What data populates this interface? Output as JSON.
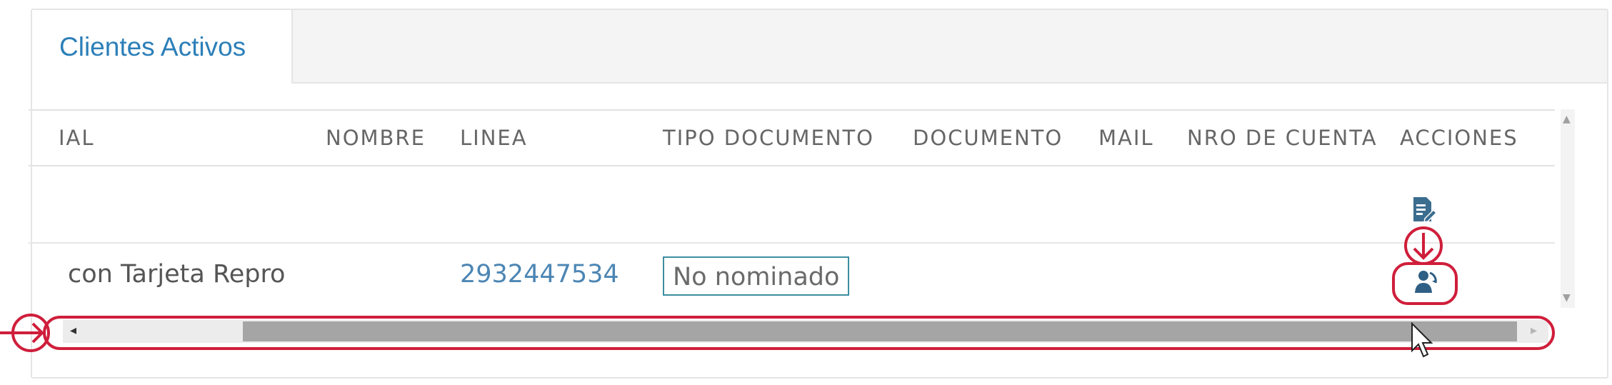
{
  "tabs": [
    {
      "label": "Clientes Activos",
      "active": true
    }
  ],
  "columns": [
    "IAL",
    "NOMBRE",
    "LINEA",
    "TIPO DOCUMENTO",
    "DOCUMENTO",
    "MAIL",
    "NRO DE CUENTA",
    "ACCIONES"
  ],
  "row": {
    "name": "con Tarjeta Repro",
    "linea": "2932447534",
    "tipo_documento": "No nominado"
  },
  "actions": [
    "edit-document-icon",
    "user-refresh-icon"
  ],
  "colors": {
    "tab_text": "#2c7fb8",
    "link": "#4c86b4",
    "annotation": "#cf1e3b",
    "doc_border": "#3d8ea0"
  }
}
